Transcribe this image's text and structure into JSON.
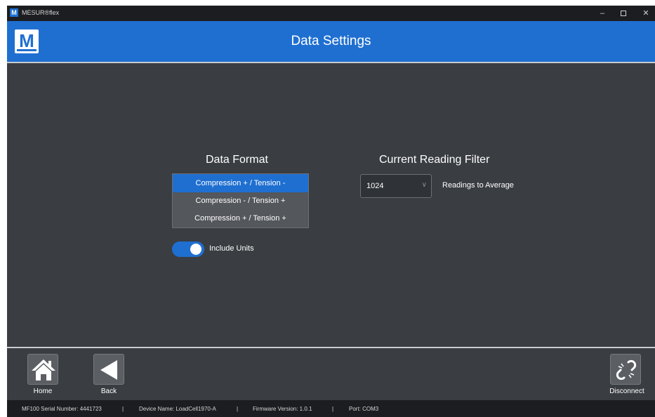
{
  "window": {
    "app_title": "MESUR®flex",
    "app_logo_letter": "M",
    "minimize_glyph": "–",
    "close_glyph": "✕"
  },
  "header": {
    "logo_letter": "M",
    "title": "Data Settings"
  },
  "data_format": {
    "title": "Data Format",
    "options": [
      {
        "label": "Compression + / Tension -",
        "selected": true
      },
      {
        "label": "Compression - / Tension +",
        "selected": false
      },
      {
        "label": "Compression + / Tension +",
        "selected": false
      }
    ],
    "include_units": {
      "label": "Include Units",
      "on": true
    }
  },
  "reading_filter": {
    "title": "Current Reading Filter",
    "value": "1024",
    "label": "Readings to Average"
  },
  "footer": {
    "home_label": "Home",
    "back_label": "Back",
    "disconnect_label": "Disconnect",
    "icons": {
      "home": "home-icon",
      "back": "back-arrow-icon",
      "disconnect": "broken-link-icon"
    }
  },
  "status": {
    "serial": "MF100 Serial Number: 4441723",
    "device": "Device Name: LoadCell1970-A",
    "firmware": "Firmware Version: 1.0.1",
    "port": "Port: COM3",
    "separator": "|"
  },
  "colors": {
    "accent": "#1f6fd1",
    "background": "#3a3d42",
    "titlebar": "#1c1d20"
  }
}
